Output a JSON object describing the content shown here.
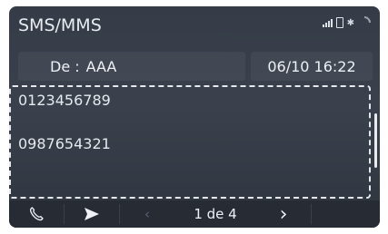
{
  "header": {
    "title": "SMS/MMS"
  },
  "message": {
    "from_label": "De :",
    "from_value": "AAA",
    "datetime": "06/10 16:22",
    "body_lines": [
      "0123456789",
      "0987654321"
    ]
  },
  "pager": {
    "text": "1 de 4"
  },
  "icons": {
    "call": "phone-icon",
    "send": "send-icon",
    "prev": "chevron-left-icon",
    "next": "chevron-right-icon",
    "signal": "signal-icon",
    "battery": "phone-battery-icon",
    "bluetooth": "bluetooth-icon",
    "wifi": "wifi-icon"
  },
  "colors": {
    "screen_bg": "#353c47",
    "text": "#eef1f5",
    "bottom_bar": "#262b34"
  }
}
